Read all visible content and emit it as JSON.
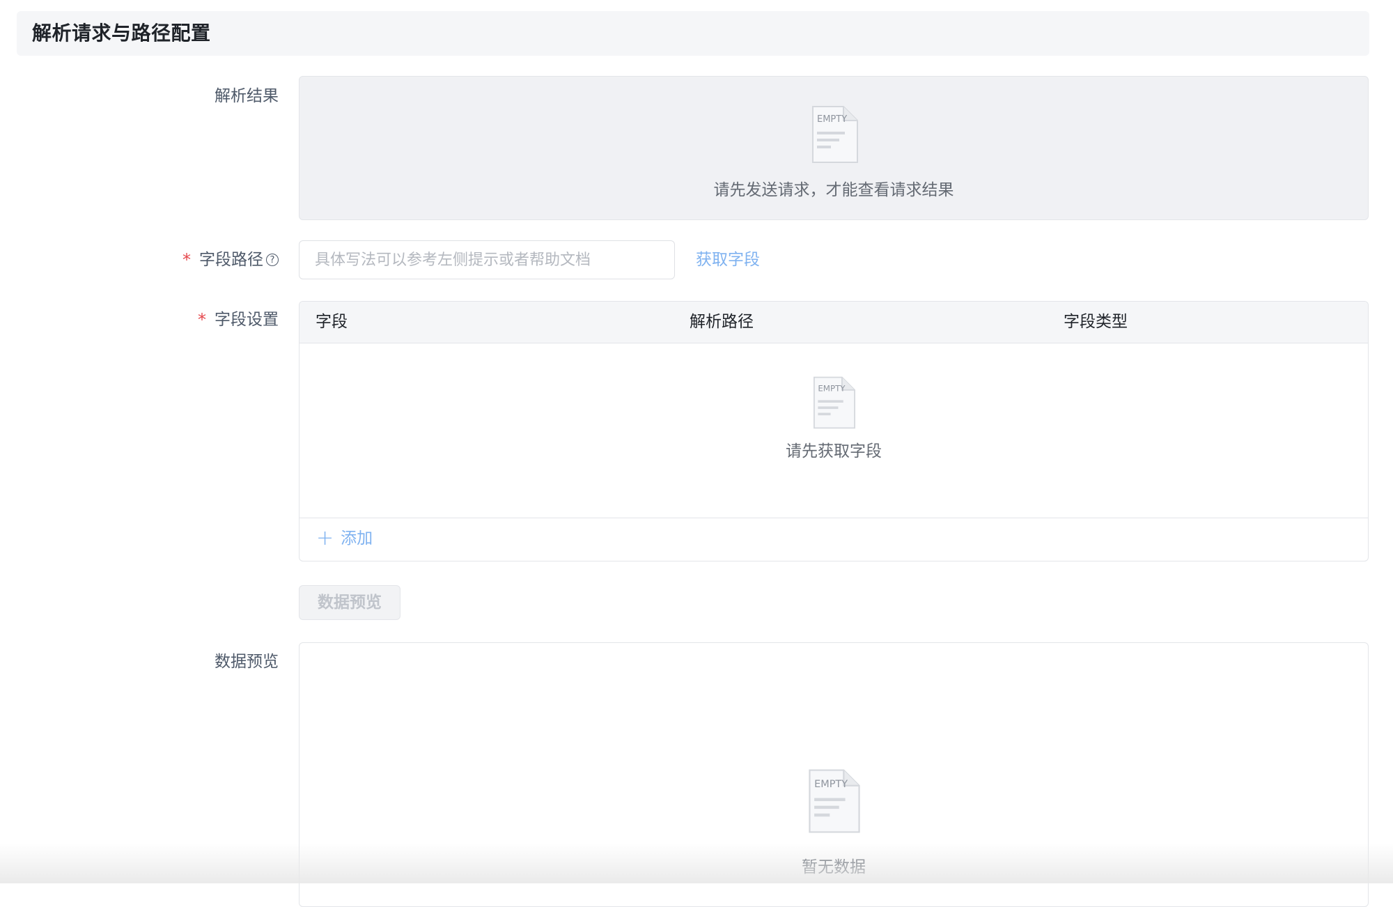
{
  "section": {
    "title": "解析请求与路径配置"
  },
  "parse_result": {
    "label": "解析结果",
    "empty_icon": "empty-document-icon",
    "empty_icon_text": "EMPTY",
    "empty_text": "请先发送请求，才能查看请求结果"
  },
  "field_path": {
    "label": "字段路径",
    "required": "*",
    "help_icon": "help-circle-icon",
    "help_glyph": "?",
    "placeholder": "具体写法可以参考左侧提示或者帮助文档",
    "value": "",
    "fetch_label": "获取字段"
  },
  "field_settings": {
    "label": "字段设置",
    "required": "*",
    "columns": [
      "字段",
      "解析路径",
      "字段类型"
    ],
    "rows": [],
    "empty_icon": "empty-document-icon",
    "empty_icon_text": "EMPTY",
    "empty_text": "请先获取字段",
    "add_icon": "plus-icon",
    "add_glyph": "+",
    "add_label": "添加"
  },
  "preview_button": {
    "label": "数据预览",
    "disabled": true
  },
  "data_preview": {
    "label": "数据预览",
    "empty_icon": "empty-document-icon",
    "empty_icon_text": "EMPTY",
    "empty_text": "暂无数据"
  },
  "colors": {
    "primary_link": "#7fb2f0",
    "required": "#e5484d",
    "label_text": "#4e5969",
    "muted_text": "#646a73",
    "header_bg": "#f5f6f8"
  }
}
